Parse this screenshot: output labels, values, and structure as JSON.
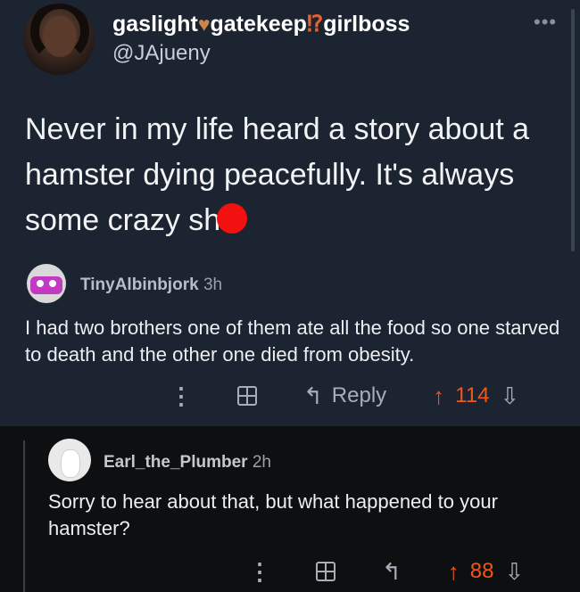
{
  "tweet": {
    "display_name_parts": [
      "gaslight",
      "gatekeep",
      "girlboss"
    ],
    "heart_glyph": "♥",
    "bang_glyph": "⁉",
    "handle": "@JAjueny",
    "more_label": "•••",
    "text": "Never in my life heard a story about a hamster dying peacefully. It's always some crazy sh",
    "redaction_color": "#f21010"
  },
  "comments": [
    {
      "username": "TinyAlbinbjork",
      "time": "3h",
      "text": "I had two brothers one of them ate all the food so one starved to death and the other one died from obesity.",
      "actions": {
        "more_label": "⋮",
        "reply_label": "Reply",
        "score": "114"
      }
    },
    {
      "username": "Earl_the_Plumber",
      "time": "2h",
      "text": "Sorry to hear about that, but what happened to your hamster?",
      "actions": {
        "more_label": "⋮",
        "score": "88"
      }
    }
  ],
  "colors": {
    "upvote": "#f0581a",
    "tweet_bg": "#1b2430",
    "reply_bg": "#0e0f11"
  },
  "icons": {
    "upvote": "↑",
    "downvote": "⇩",
    "reply": "↰"
  }
}
